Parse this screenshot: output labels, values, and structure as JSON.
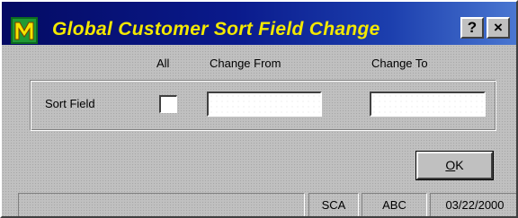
{
  "window": {
    "title": "Global Customer Sort Field Change",
    "help_label": "?",
    "close_label": "×"
  },
  "headers": {
    "all": "All",
    "change_from": "Change From",
    "change_to": "Change To"
  },
  "row": {
    "label": "Sort Field",
    "all_checked": false,
    "change_from_value": "",
    "change_to_value": ""
  },
  "buttons": {
    "ok_mnemonic": "O",
    "ok_rest": "K"
  },
  "statusbar": {
    "message": "",
    "company": "SCA",
    "user": "ABC",
    "date": "03/22/2000"
  },
  "colors": {
    "title_text": "#f3e800",
    "title_bar_start": "#040a63",
    "title_bar_end": "#4b78d2",
    "face": "#c0c0c0"
  },
  "icons": {
    "app": "app-m-icon",
    "help": "help-question-icon",
    "close": "close-x-icon"
  }
}
